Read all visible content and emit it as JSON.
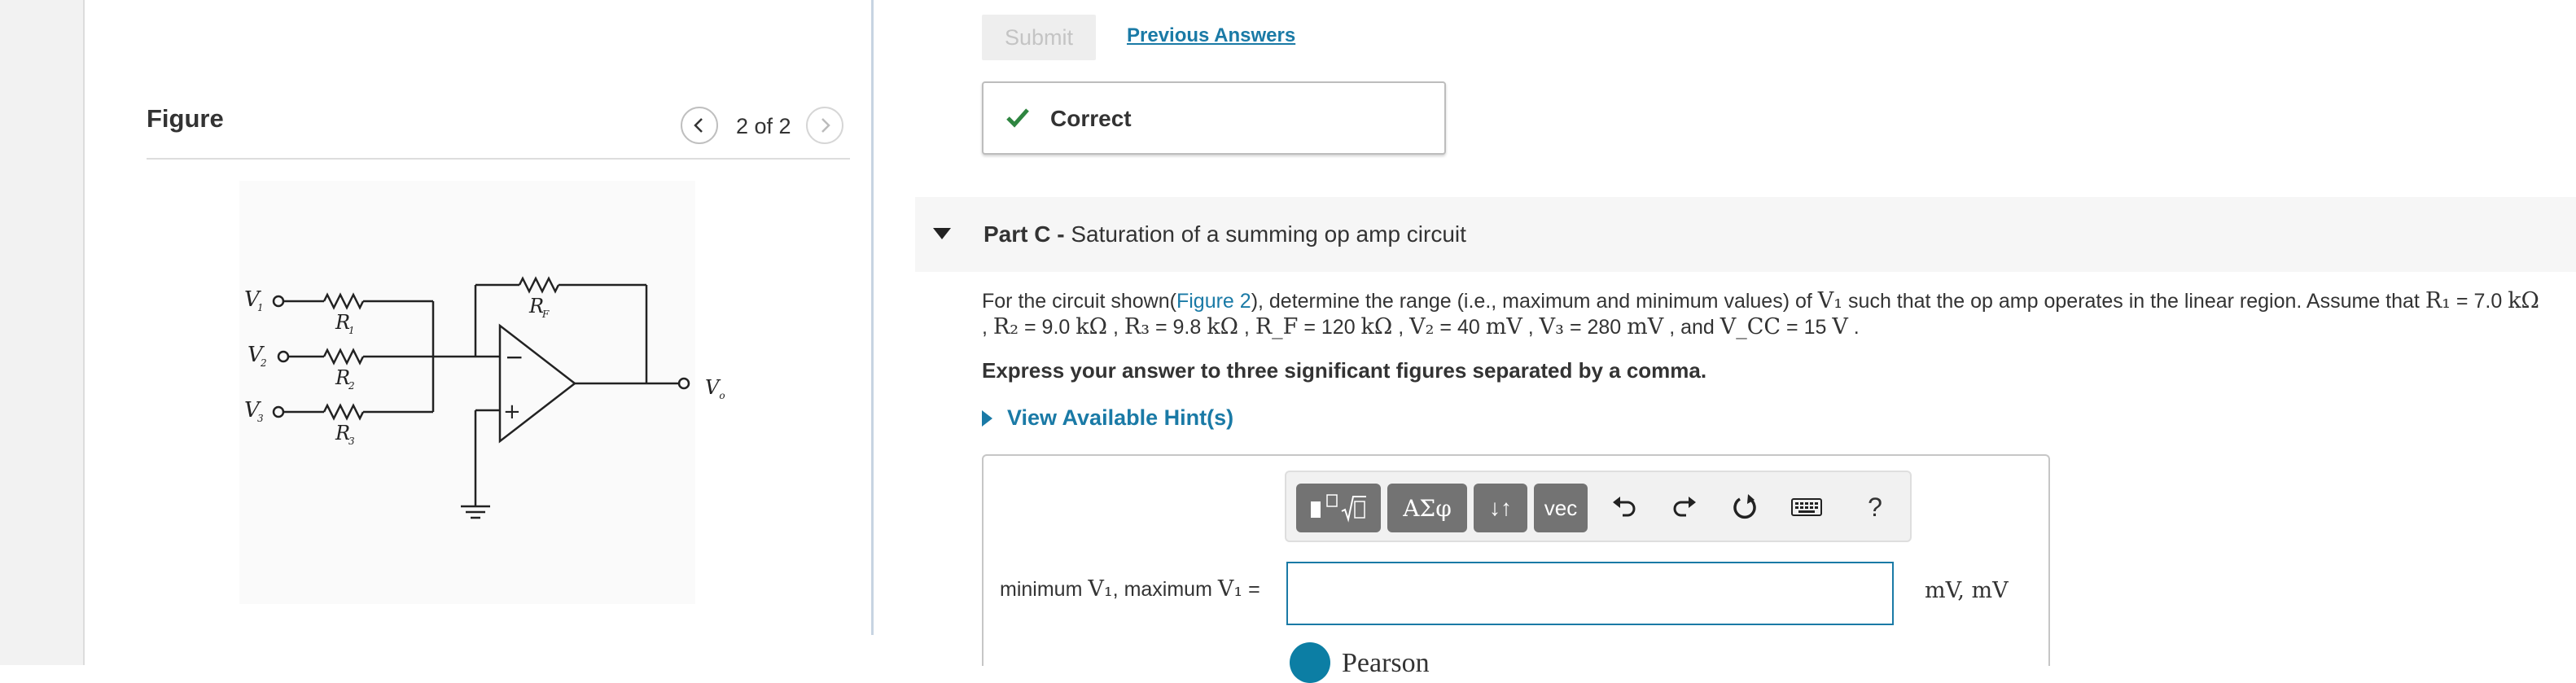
{
  "figure": {
    "title": "Figure",
    "counter": "2 of 2",
    "circuit_labels": {
      "v1": "V",
      "v1_sub": "1",
      "v2": "V",
      "v2_sub": "2",
      "v3": "V",
      "v3_sub": "3",
      "r1": "R",
      "r1_sub": "1",
      "r2": "R",
      "r2_sub": "2",
      "r3": "R",
      "r3_sub": "3",
      "rf": "R",
      "rf_sub": "F",
      "vo": "V",
      "vo_sub": "o",
      "minus": "−",
      "plus": "+"
    }
  },
  "actions": {
    "submit_label": "Submit",
    "previous_answers_label": "Previous Answers"
  },
  "feedback": {
    "status": "Correct",
    "color": "#2e8540"
  },
  "part": {
    "prefix": "Part C -",
    "title": "Saturation of a summing op amp circuit"
  },
  "problem": {
    "t1": "For the circuit shown(",
    "figure_link": "Figure 2",
    "t2": "), determine the range (i.e., maximum and minimum values) of ",
    "v1": "V₁",
    "t3": " such that the op amp operates in the linear region. Assume that ",
    "r1": "R₁",
    "t4": " = 7.0 ",
    "kohm1": "kΩ",
    "t5": " , ",
    "r2": "R₂",
    "t6": " = 9.0 ",
    "kohm2": "kΩ",
    "t7": " , ",
    "r3": "R₃",
    "t8": " = 9.8 ",
    "kohm3": "kΩ",
    "t9": " , ",
    "rf": "R_F",
    "t10": " = 120 ",
    "kohm4": "kΩ",
    "t11": " , ",
    "v2": "V₂",
    "t12": " = 40 ",
    "mv1": "mV",
    "t13": " , ",
    "v3": "V₃",
    "t14": " = 280 ",
    "mv2": "mV",
    "t15": " , and ",
    "vcc": "V_CC",
    "t16": " = 15 ",
    "volt": "V",
    "t17": " ."
  },
  "instruction": "Express your answer to three significant figures separated by a comma.",
  "hints_label": "View Available Hint(s)",
  "toolbar": {
    "templates_label": "√",
    "greek_label": "ΑΣφ",
    "arrows_label": "↓↑",
    "vec_label": "vec",
    "help_label": "?"
  },
  "answer": {
    "label_min": "minimum ",
    "label_v1a": "V₁",
    "label_sep": ", maximum ",
    "label_v1b": "V₁",
    "label_eq": " =",
    "value": "",
    "units": "mV, mV"
  },
  "footer": {
    "brand": "Pearson"
  }
}
